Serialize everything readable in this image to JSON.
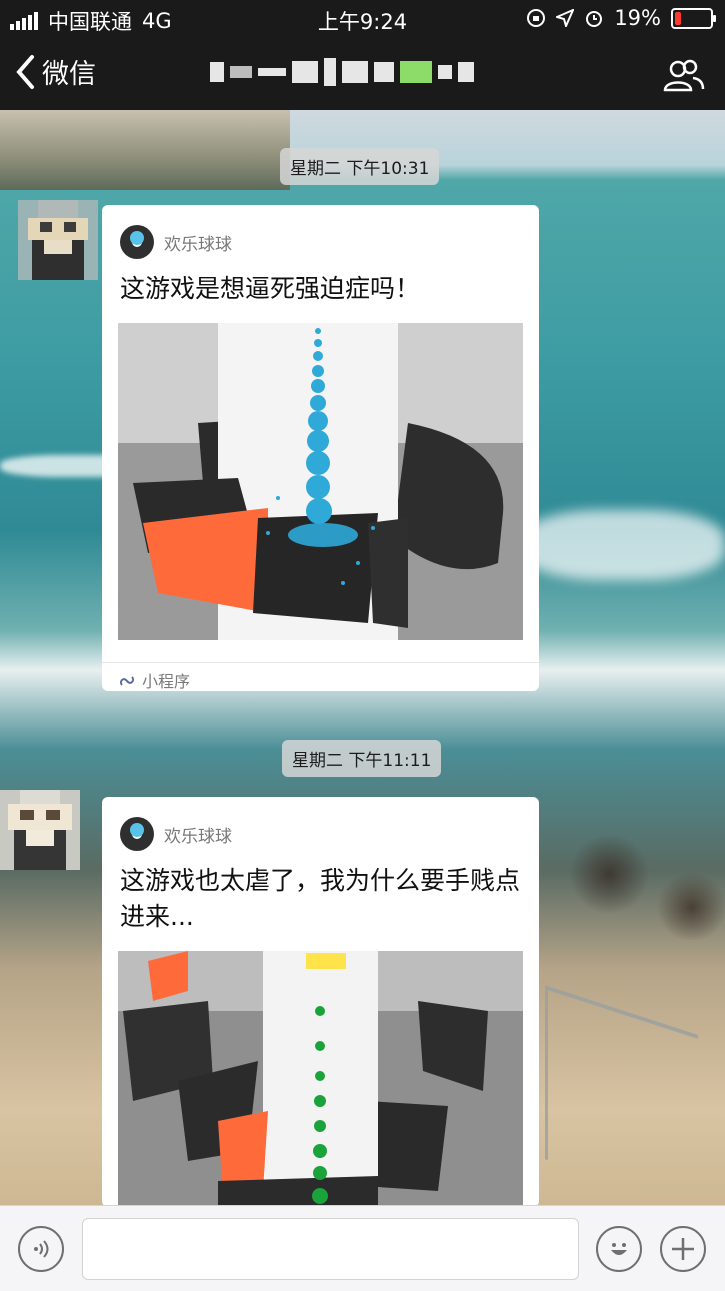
{
  "status_bar": {
    "carrier": "中国联通",
    "network": "4G",
    "time": "上午9:24",
    "battery": "19%",
    "battery_level": 0.19,
    "icons": [
      "signal-icon",
      "rotation-lock-icon",
      "location-icon",
      "alarm-icon",
      "battery-icon"
    ]
  },
  "nav": {
    "back_label": "微信",
    "icons": [
      "chevron-left-icon",
      "group-members-icon"
    ]
  },
  "messages": [
    {
      "timestamp": "星期二 下午10:31",
      "app_name": "欢乐球球",
      "title": "这游戏是想逼死强迫症吗！",
      "footer": "小程序"
    },
    {
      "timestamp": "星期二 下午11:11",
      "app_name": "欢乐球球",
      "title": "这游戏也太虐了，我为什么要手贱点进来..."
    }
  ],
  "input_bar": {
    "icons": [
      "voice-icon",
      "emoji-icon",
      "plus-icon"
    ]
  },
  "colors": {
    "accent_orange": "#ff6a3a",
    "ball_blue": "#2ea9d8",
    "ball_green": "#1aa33a",
    "battery_red": "#ff3b30"
  }
}
